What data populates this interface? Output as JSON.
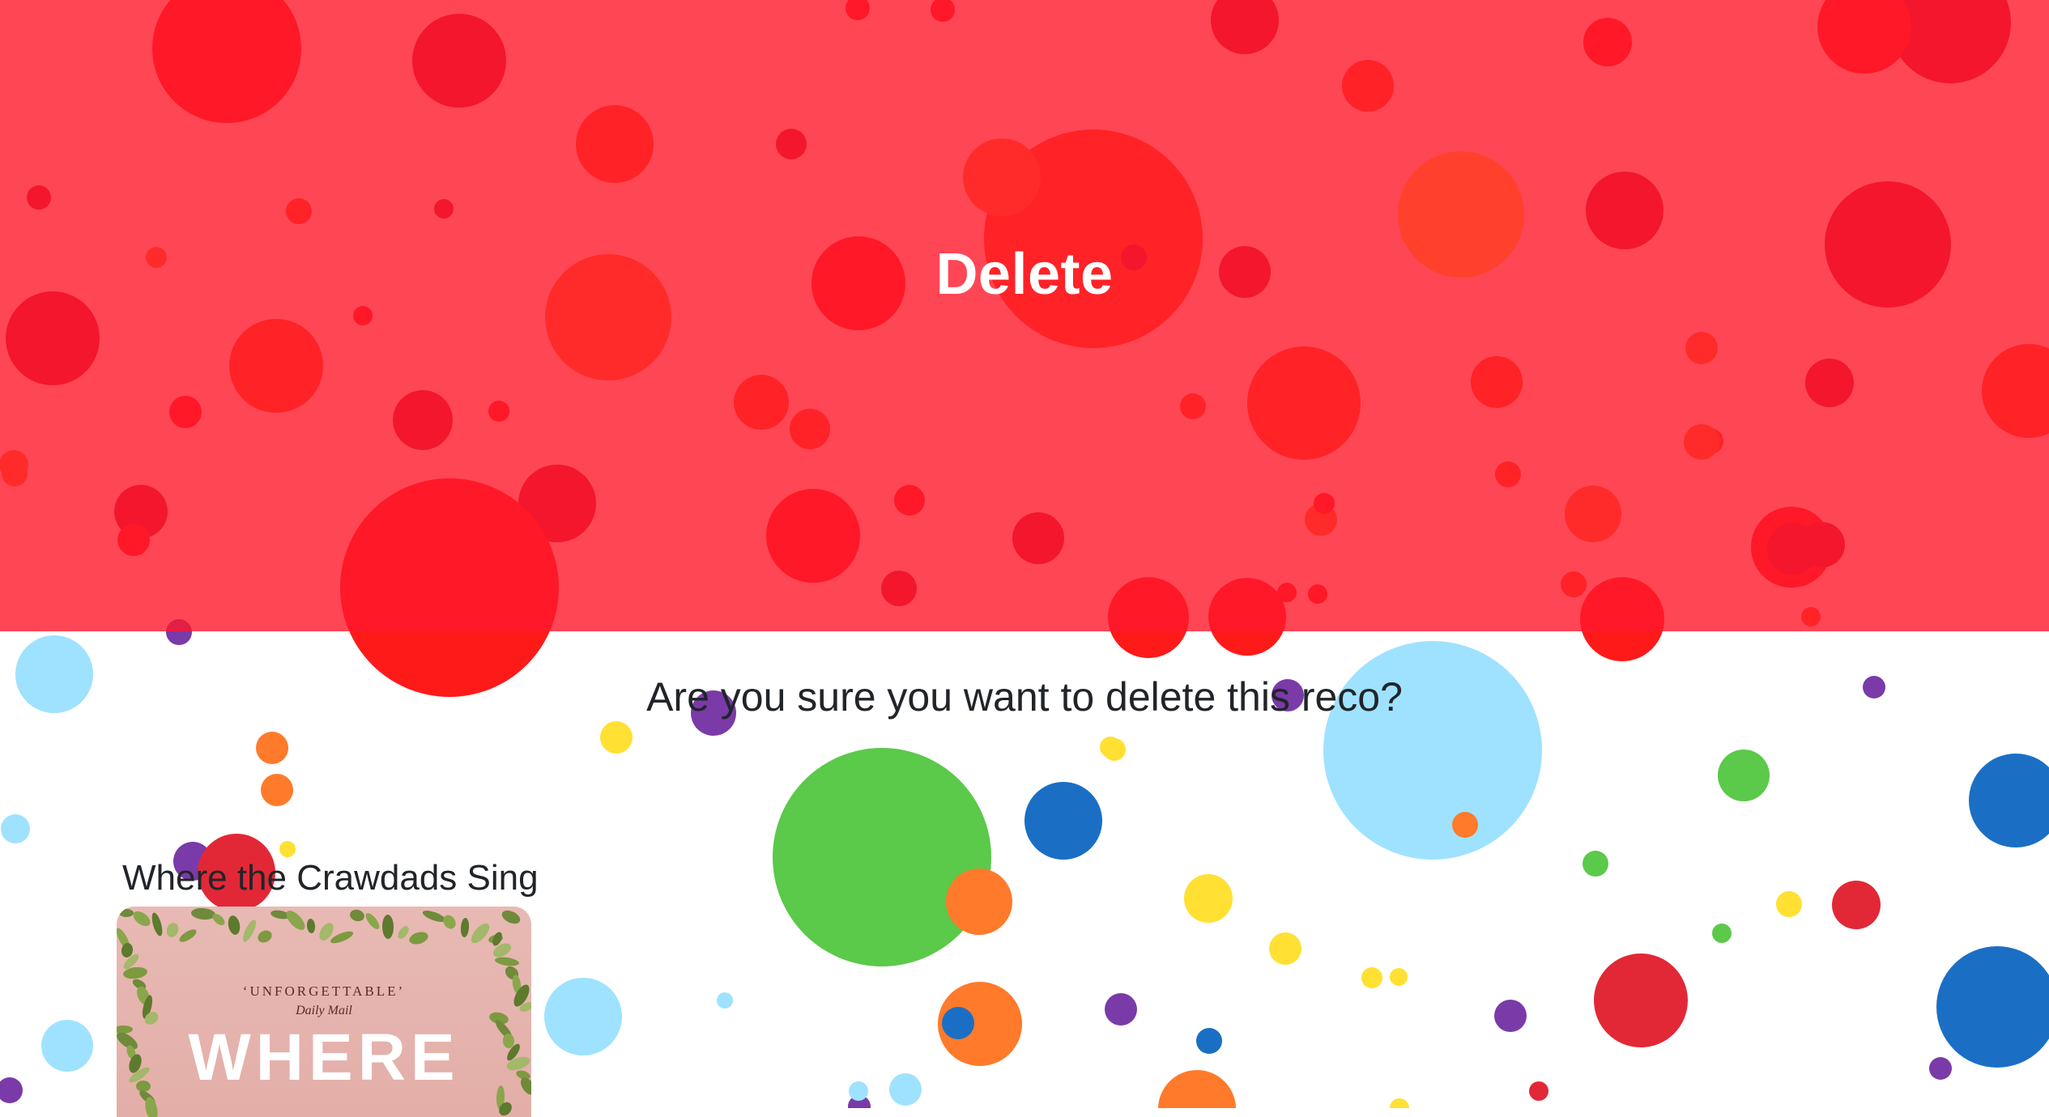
{
  "banner": {
    "title": "Delete",
    "color": "#ff182a"
  },
  "confirm": {
    "question": "Are you sure you want to delete this reco?"
  },
  "reco": {
    "title": "Where the Crawdads Sing",
    "cover": {
      "quote": "‘UNFORGETTABLE’",
      "source": "Daily Mail",
      "word": "WHERE"
    }
  },
  "confetti_colors": [
    "#ff1a1a",
    "#c41237",
    "#ff4a1a",
    "#7a3aa8",
    "#5bc94a",
    "#1a6fc4",
    "#9fe2ff",
    "#ffe033",
    "#ff7a2a",
    "#e22836"
  ]
}
